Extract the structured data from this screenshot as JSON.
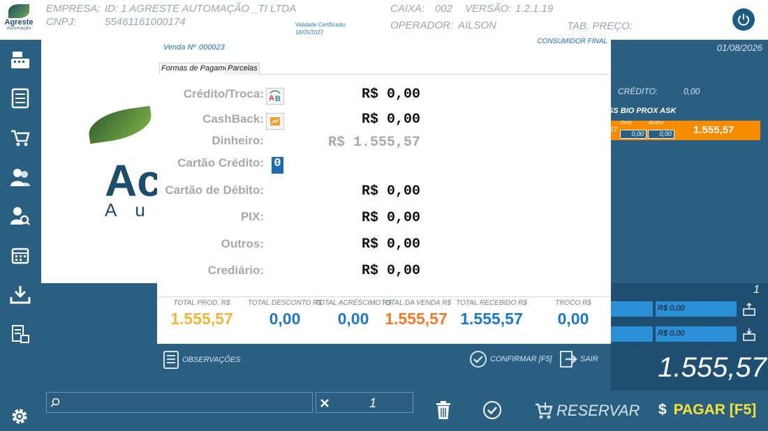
{
  "header": {
    "logo_name": "Agreste",
    "logo_sub": "Automação",
    "empresa_label": "EMPRESA:",
    "empresa_value": "ID: 1 AGRESTE AUTOMAÇÃO _TI LTDA",
    "cnpj_label": "CNPJ:",
    "cnpj_value": "55461161000174",
    "cert_label": "Validade Certificado:",
    "cert_value": "18/05/2027",
    "caixa_label": "CAIXA:",
    "caixa_value": "002",
    "versao_label": "VERSÃO:",
    "versao_value": "1.2.1.19",
    "operador_label": "OPERADOR:",
    "operador_value": "AILSON",
    "tab_preco_label": "TAB. PREÇO:"
  },
  "sidebar": {
    "items": [
      "cash-register-icon",
      "receipt-icon",
      "cart-return-icon",
      "customers-icon",
      "search-customer-icon",
      "calendar-icon",
      "download-icon",
      "export-list-icon"
    ]
  },
  "background": {
    "logo_big": "Ac",
    "logo_sub": "Au"
  },
  "right_panel": {
    "date": "01/08/2026",
    "credit_label": "CRÉDITO:",
    "credit_value": "0,00",
    "item_name": "SS BIO PROX ASK",
    "item_qty": "57",
    "desc_label": "Desc",
    "desc_value": "0,00",
    "acresc_label": "Acrésc",
    "acresc_value": "0,00",
    "item_total": "1.555,57",
    "count": "1",
    "field1": "R$ 0,00",
    "field2": "R$ 0,00",
    "grand_total": "1.555,57"
  },
  "bottombar": {
    "qty": "1",
    "reserve_label": "RESERVAR",
    "pay_currency": "$",
    "pay_label": "PAGAR [F5]"
  },
  "modal": {
    "sale_label": "Venda Nº",
    "sale_number": "000023",
    "consumer": "CONSUMIDOR FINAL",
    "tabs": [
      "Formas de Pagamento",
      "Parcelas"
    ],
    "payments": [
      {
        "label": "Crédito/Troca:",
        "value": "R$ 0,00"
      },
      {
        "label": "CashBack:",
        "value": "R$ 0,00"
      },
      {
        "label": "Dinheiro:",
        "value": "R$ 1.555,57"
      },
      {
        "label": "Cartão Crédito:",
        "value": "0"
      },
      {
        "label": "Cartão de Débito:",
        "value": "R$ 0,00"
      },
      {
        "label": "PIX:",
        "value": "R$ 0,00"
      },
      {
        "label": "Outros:",
        "value": "R$ 0,00"
      },
      {
        "label": "Crediário:",
        "value": "R$ 0,00"
      }
    ],
    "totals": [
      {
        "label": "TOTAL PROD. R$",
        "value": "1.555,57",
        "color": "#f3b63a"
      },
      {
        "label": "TOTAL DESCONTO R$",
        "value": "0,00",
        "color": "#1f77c4"
      },
      {
        "label": "TOTAL ACRÉSCIMO R$",
        "value": "0,00",
        "color": "#1f77c4"
      },
      {
        "label": "TOTAL DA VENDA R$",
        "value": "1.555,57",
        "color": "#f07a2a"
      },
      {
        "label": "TOTAL RECEBIDO R$",
        "value": "1.555,57",
        "color": "#1f77c4"
      },
      {
        "label": "TROCO R$",
        "value": "0,00",
        "color": "#1f77c4"
      }
    ],
    "obs_label": "OBSERVAÇÕES",
    "confirm_label": "CONFIRMAR [F5]",
    "exit_label": "SAIR"
  }
}
